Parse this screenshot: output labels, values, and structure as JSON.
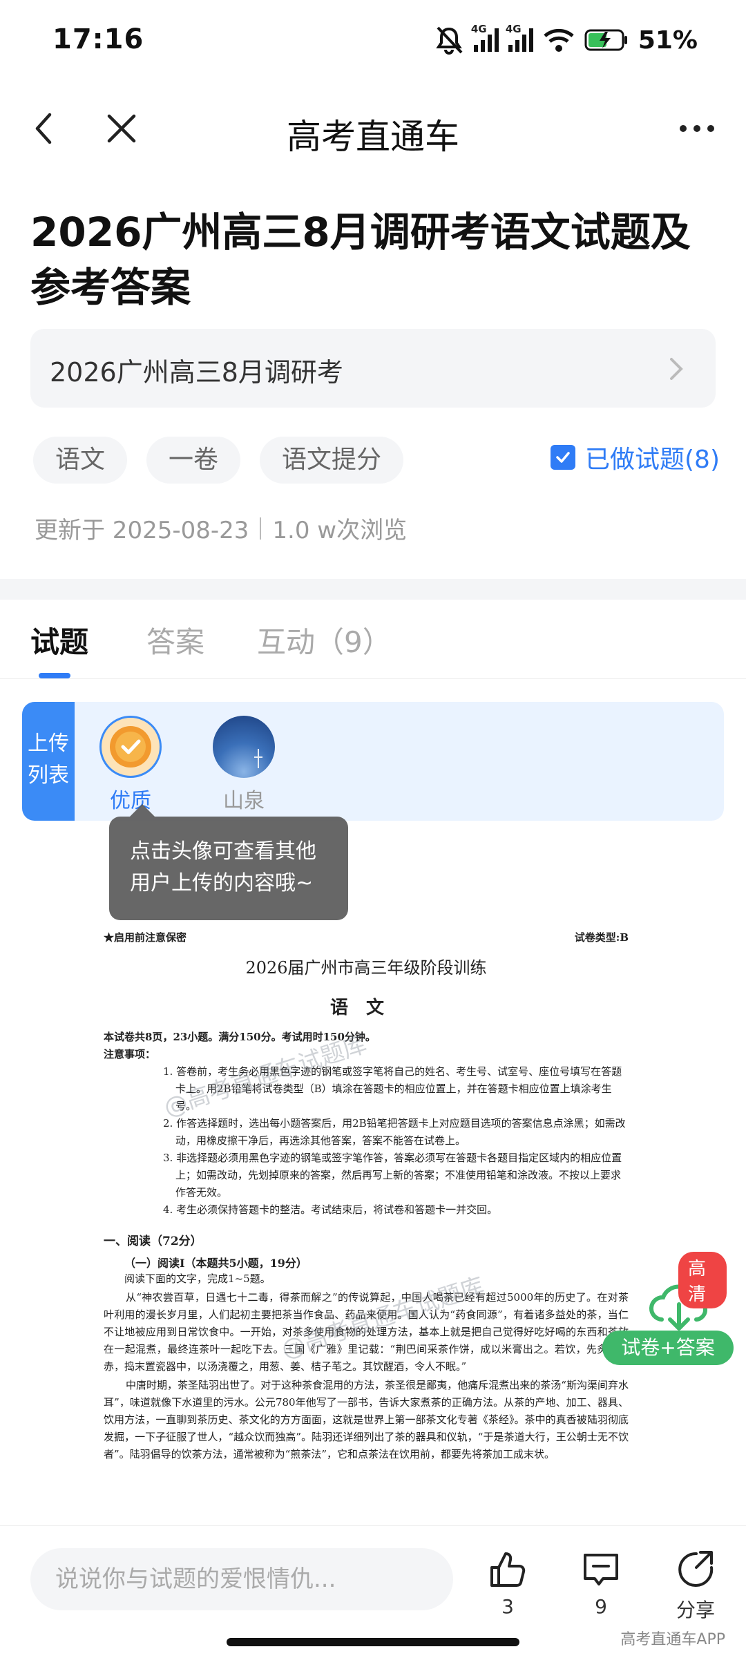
{
  "status": {
    "time": "17:16",
    "battery": "51%",
    "net1": "4G",
    "net2": "4G"
  },
  "nav": {
    "title": "高考直通车"
  },
  "article": {
    "title": "2026广州高三8月调研考语文试题及参考答案",
    "series": "2026广州高三8月调研考",
    "tags": [
      "语文",
      "一卷",
      "语文提分"
    ],
    "done_label": "已做试题(8)",
    "updated": "更新于 2025-08-23",
    "views": "1.0 w次浏览"
  },
  "tabs": [
    {
      "label": "试题",
      "active": true
    },
    {
      "label": "答案",
      "active": false
    },
    {
      "label": "互动（9）",
      "active": false
    }
  ],
  "upload": {
    "side_label": "上传列表",
    "uploaders": [
      {
        "name": "优质",
        "active": true
      },
      {
        "name": "山泉",
        "active": false
      }
    ],
    "tooltip": "点击头像可查看其他用户上传的内容哦~"
  },
  "doc": {
    "confidential": "★启用前注意保密",
    "paper_type": "试卷类型:B",
    "exam_title": "2026届广州市高三年级阶段训练",
    "subject": "语文",
    "summary": "本试卷共8页，23小题。满分150分。考试用时150分钟。",
    "notes_label": "注意事项：",
    "notes": [
      "1. 答卷前，考生务必用黑色字迹的钢笔或签字笔将自己的姓名、考生号、试室号、座位号填写在答题卡上。用2B铅笔将试卷类型（B）填涂在答题卡的相应位置上，并在答题卡相应位置上填涂考生号。",
      "2. 作答选择题时，选出每小题答案后，用2B铅笔把答题卡上对应题目选项的答案信息点涂黑；如需改动，用橡皮擦干净后，再选涂其他答案，答案不能答在试卷上。",
      "3. 非选择题必须用黑色字迹的钢笔或签字笔作答，答案必须写在答题卡各题目指定区域内的相应位置上；如需改动，先划掉原来的答案，然后再写上新的答案；不准使用铅笔和涂改液。不按以上要求作答无效。",
      "4. 考生必须保持答题卡的整洁。考试结束后，将试卷和答题卡一并交回。"
    ],
    "section": "一、阅读（72分）",
    "subsection": "（一）阅读Ⅰ（本题共5小题，19分）",
    "instruction": "阅读下面的文字，完成1~5题。",
    "paragraphs": [
      "从“神农尝百草，日遇七十二毒，得茶而解之”的传说算起，中国人喝茶已经有超过5000年的历史了。在对茶叶利用的漫长岁月里，人们起初主要把茶当作食品、药品来使用。国人认为“药食同源”，有着诸多益处的茶，当仁不让地被应用到日常饮食中。一开始，对茶多使用食物的处理方法，基本上就是把自己觉得好吃好喝的东西和茶放在一起混煮，最终连茶叶一起吃下去。三国《广雅》里记载：“荆巴间采茶作饼，成以米膏出之。若饮，先炙令色赤，捣末置瓷器中，以汤浇覆之，用葱、姜、桔子芼之。其饮醒酒，令人不眠。”",
      "中唐时期，茶圣陆羽出世了。对于这种茶食混用的方法，茶圣很是鄙夷，他痛斥混煮出来的茶汤“斯沟渠间弃水耳”，味道就像下水道里的污水。公元780年他写了一部书，告诉大家煮茶的正确方法。从茶的产地、加工、器具、饮用方法，一直聊到茶历史、茶文化的方方面面，这就是世界上第一部茶文化专著《茶经》。茶中的真香被陆羽彻底发掘，一下子征服了世人，“越众饮而独高”。陆羽还详细列出了茶的器具和仪轨，“于是茶道大行，王公朝士无不饮者”。陆羽倡导的饮茶方法，通常被称为“煎茶法”，它和点茶法在饮用前，都要先将茶加工成末状。"
    ],
    "watermark": "@高考直通车试题库"
  },
  "badge": {
    "hd": "高清",
    "label": "试卷+答案"
  },
  "bottom": {
    "placeholder": "说说你与试题的爱恨情仇...",
    "likes": "3",
    "comments": "9",
    "share": "分享",
    "credit": "高考直通车APP"
  }
}
